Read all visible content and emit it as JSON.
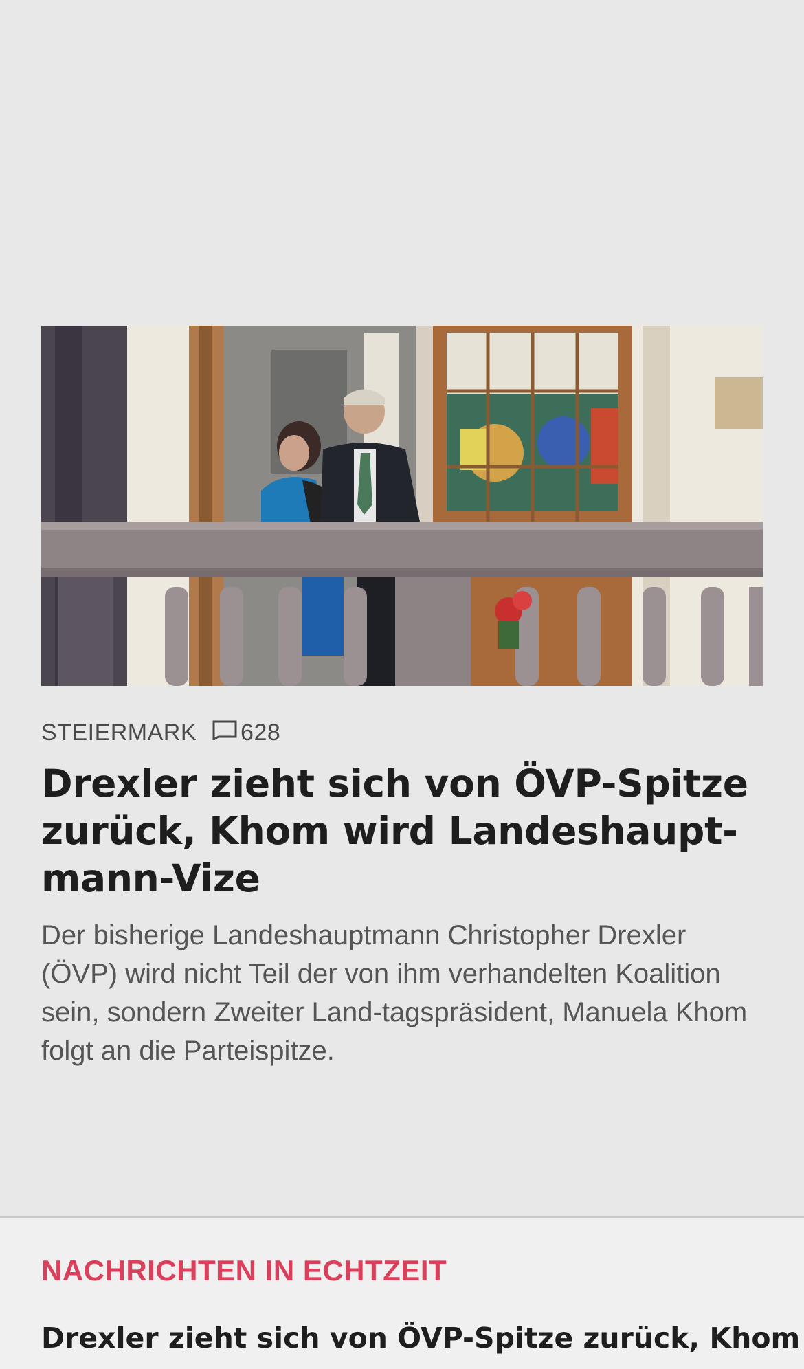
{
  "article": {
    "section": "STEIERMARK",
    "comment_count": "628",
    "headline": "Drexler zieht sich von ÖVP-Spitze zurück, Khom wird Landeshaupt-mann-Vize",
    "lead": "Der bisherige Landeshauptmann Christopher Drexler (ÖVP) wird nicht Teil der von ihm verhandelten Koalition sein, sondern Zweiter Land-tagspräsident, Manuela Khom folgt an die Parteispitze.",
    "image_icon": "photo-of-politicians-on-balcony"
  },
  "live": {
    "label": "NACHRICHTEN IN ECHTZEIT",
    "first_headline": "Drexler zieht sich von ÖVP-Spitze zurück, Khom"
  },
  "colors": {
    "background": "#e8e8e8",
    "live_background": "#f0f0f0",
    "accent": "#d9405b",
    "text": "#1e1e1e",
    "muted": "#555555"
  }
}
